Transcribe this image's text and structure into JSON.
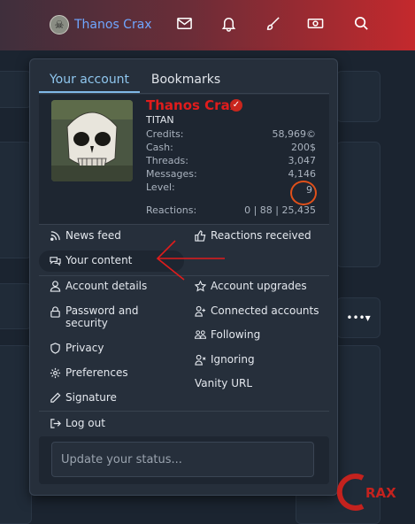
{
  "topbar": {
    "username": "Thanos Crax",
    "icons": [
      "envelope-icon",
      "bell-icon",
      "brush-icon",
      "money-icon",
      "search-icon"
    ]
  },
  "tabs": [
    {
      "label": "Your account",
      "active": true
    },
    {
      "label": "Bookmarks",
      "active": false
    }
  ],
  "profile": {
    "name": "Thanos Crax",
    "rank": "TITAN",
    "stats": [
      {
        "label": "Credits:",
        "value": "58,969©"
      },
      {
        "label": "Cash:",
        "value": "200$"
      },
      {
        "label": "Threads:",
        "value": "3,047"
      },
      {
        "label": "Messages:",
        "value": "4,146"
      },
      {
        "label": "Level:",
        "value": "9"
      }
    ],
    "reactions_label": "Reactions:",
    "reactions_value": "0 | 88 | 25,435"
  },
  "menu": {
    "news_feed": "News feed",
    "reactions_received": "Reactions received",
    "your_content": "Your content",
    "account_details": "Account details",
    "account_upgrades": "Account upgrades",
    "password_security": "Password and security",
    "connected_accounts": "Connected accounts",
    "following": "Following",
    "privacy": "Privacy",
    "ignoring": "Ignoring",
    "preferences": "Preferences",
    "vanity_url": "Vanity URL",
    "signature": "Signature",
    "log_out": "Log out"
  },
  "status": {
    "placeholder": "Update your status..."
  },
  "watermark": {
    "text": "RAX"
  },
  "colors": {
    "accent": "#7fb8e6",
    "username": "#e01c1c",
    "annotation": "#e0501a"
  }
}
